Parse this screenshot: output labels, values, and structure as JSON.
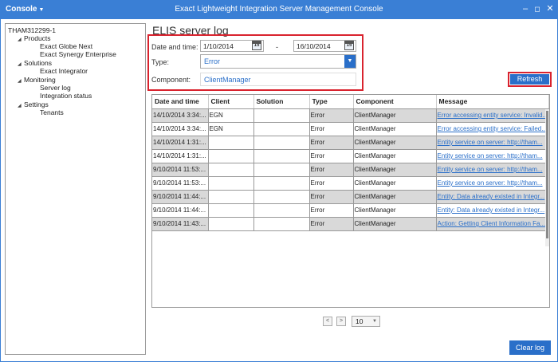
{
  "titlebar": {
    "menu_label": "Console",
    "title": "Exact Lightweight Integration Server Management Console",
    "minimize": "–",
    "restore": "◻",
    "close": "✕"
  },
  "tree": {
    "root": "THAM312299-1",
    "products": "Products",
    "exact_globe_next": "Exact Globe Next",
    "exact_synergy": "Exact Synergy Enterprise",
    "solutions": "Solutions",
    "exact_integrator": "Exact Integrator",
    "monitoring": "Monitoring",
    "server_log": "Server log",
    "integration_status": "Integration status",
    "settings": "Settings",
    "tenants": "Tenants"
  },
  "page": {
    "title": "ELIS server log"
  },
  "filters": {
    "date_label": "Date and time:",
    "date_from": "1/10/2014",
    "date_to": "16/10/2014",
    "calendar_day": "15",
    "dash": "-",
    "type_label": "Type:",
    "type_value": "Error",
    "component_label": "Component:",
    "component_value": "ClientManager"
  },
  "buttons": {
    "refresh": "Refresh",
    "clear_log": "Clear log"
  },
  "table": {
    "headers": [
      "Date and time",
      "Client",
      "Solution",
      "Type",
      "Component",
      "Message"
    ],
    "rows": [
      [
        "14/10/2014 3:34:...",
        "EGN",
        "",
        "Error",
        "ClientManager",
        "Error accessing entity service: Invalid..."
      ],
      [
        "14/10/2014 3:34:...",
        "EGN",
        "",
        "Error",
        "ClientManager",
        "Error accessing entity service: Failed..."
      ],
      [
        "14/10/2014 1:31:...",
        "",
        "",
        "Error",
        "ClientManager",
        "Entity service on server: http://tham..."
      ],
      [
        "14/10/2014 1:31:...",
        "",
        "",
        "Error",
        "ClientManager",
        "Entity service on server: http://tham..."
      ],
      [
        "9/10/2014 11:53:...",
        "",
        "",
        "Error",
        "ClientManager",
        "Entity service on server: http://tham..."
      ],
      [
        "9/10/2014 11:53:...",
        "",
        "",
        "Error",
        "ClientManager",
        "Entity service on server: http://tham..."
      ],
      [
        "9/10/2014 11:44:...",
        "",
        "",
        "Error",
        "ClientManager",
        "Entity: Data already existed in Integr..."
      ],
      [
        "9/10/2014 11:44:...",
        "",
        "",
        "Error",
        "ClientManager",
        "Entity: Data already existed in Integr..."
      ],
      [
        "9/10/2014 11:43:...",
        "",
        "",
        "Error",
        "ClientManager",
        "Action: Getting Client Information Fa..."
      ]
    ]
  },
  "pager": {
    "prev": "<",
    "next": ">",
    "page_size": "10"
  },
  "colors": {
    "accent": "#2a6fc9",
    "titlebar": "#3a7fd5",
    "highlight": "#d9232e"
  }
}
